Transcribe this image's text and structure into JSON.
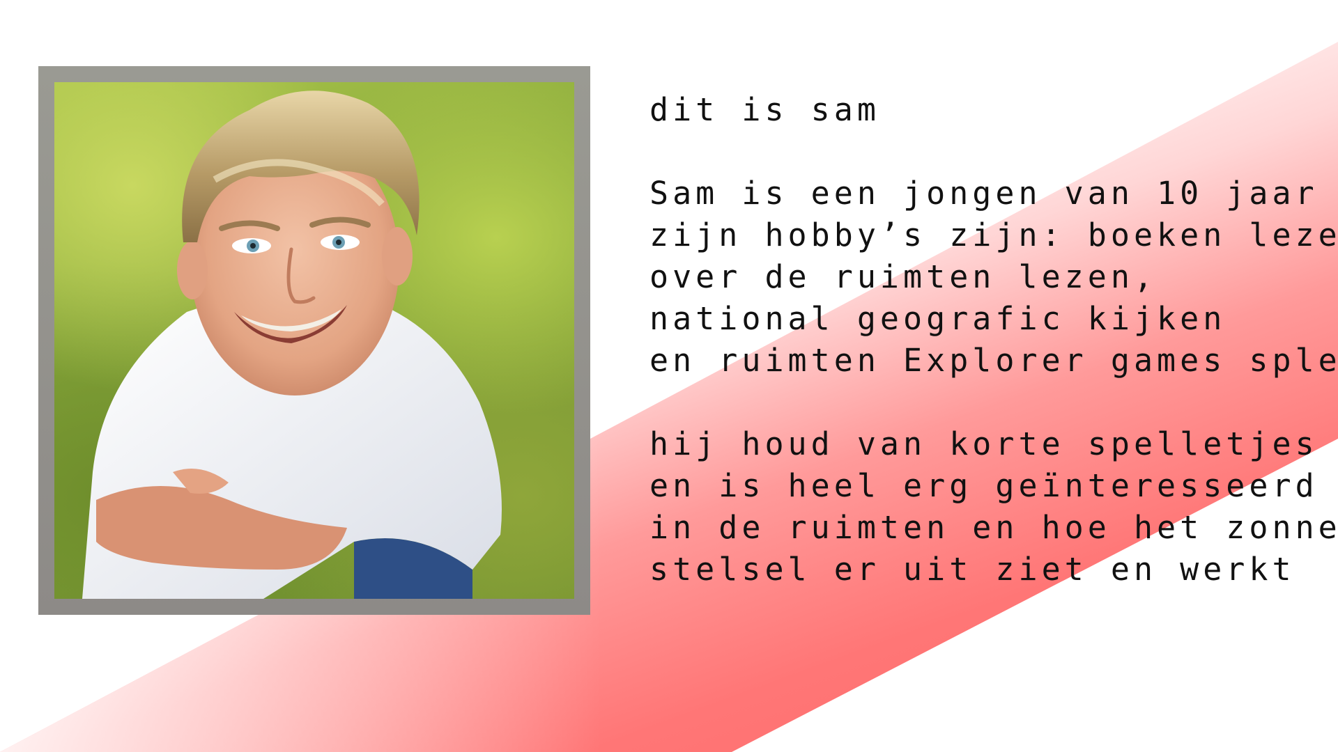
{
  "slide": {
    "heading": "dit is sam",
    "paragraph1": [
      "Sam is een jongen van 10 jaar",
      "zijn hobby’s zijn: boeken lezen",
      "over de ruimten lezen,",
      "national geografic kijken",
      "en ruimten Explorer games spleen"
    ],
    "paragraph2": [
      "hij houd van korte spelletjes",
      "en is heel erg geïnteresseerd",
      "in de ruimten en hoe het zonnen",
      "stelsel er uit ziet en werkt"
    ]
  },
  "colors": {
    "accent_red": "#ff6a6a",
    "frame_gray": "#8d8a87",
    "text": "#111111"
  }
}
